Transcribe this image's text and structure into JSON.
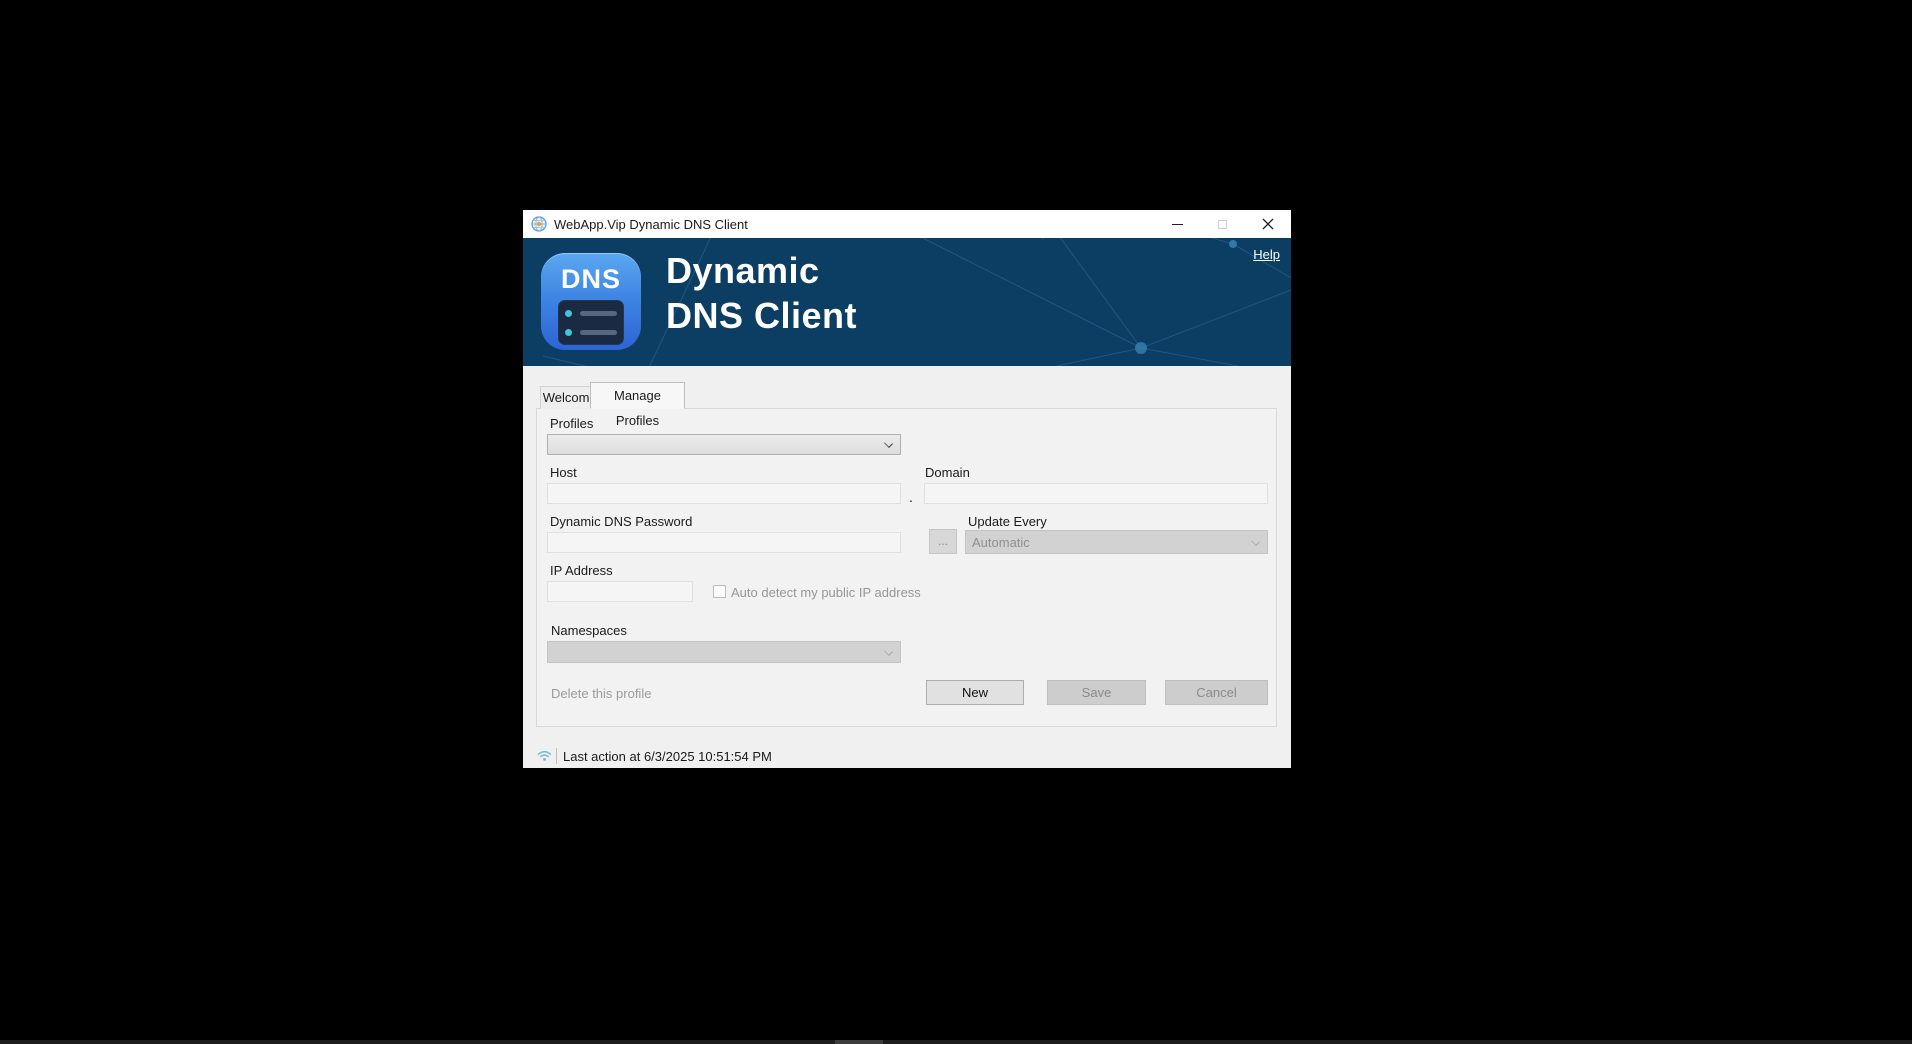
{
  "window": {
    "title": "WebApp.Vip Dynamic DNS Client"
  },
  "titlebar": {
    "icons": {
      "app": "globe-icon",
      "minimize": "minimize-dash",
      "maximize": "maximize-square-disabled",
      "close": "close-x"
    }
  },
  "header": {
    "help_label": "Help",
    "logo_text": "DNS",
    "title_line1": "Dynamic",
    "title_line2": "DNS Client",
    "background_color": "#0c3d63",
    "logo_gradient_top": "#5ba8f0",
    "logo_gradient_bottom": "#2d64d4",
    "server_dot_color": "#40c5dc"
  },
  "tabs": [
    {
      "label": "Welcome!",
      "active": false
    },
    {
      "label": "Manage Profiles",
      "active": true
    }
  ],
  "form": {
    "profiles": {
      "label": "Profiles",
      "value": ""
    },
    "host": {
      "label": "Host",
      "value": ""
    },
    "separator": ".",
    "domain": {
      "label": "Domain",
      "value": ""
    },
    "password": {
      "label": "Dynamic DNS Password",
      "value": ""
    },
    "browse_button_label": "...",
    "update_every": {
      "label": "Update Every",
      "value": "Automatic",
      "enabled": false
    },
    "ip_address": {
      "label": "IP Address",
      "value": ""
    },
    "auto_detect": {
      "label": "Auto detect my public IP address",
      "checked": false
    },
    "namespaces": {
      "label": "Namespaces",
      "value": "",
      "enabled": false
    },
    "delete_link_label": "Delete this profile",
    "buttons": {
      "new": {
        "label": "New",
        "enabled": true
      },
      "save": {
        "label": "Save",
        "enabled": false
      },
      "cancel": {
        "label": "Cancel",
        "enabled": false
      }
    }
  },
  "statusbar": {
    "icon": "wifi-icon",
    "text": "Last action at 6/3/2025 10:51:54 PM"
  },
  "colors": {
    "header_bg": "#0c3d63",
    "client_bg": "#f0f0f0",
    "disabled_text": "#8f8f8f",
    "accent_blue": "#3f86e4"
  }
}
